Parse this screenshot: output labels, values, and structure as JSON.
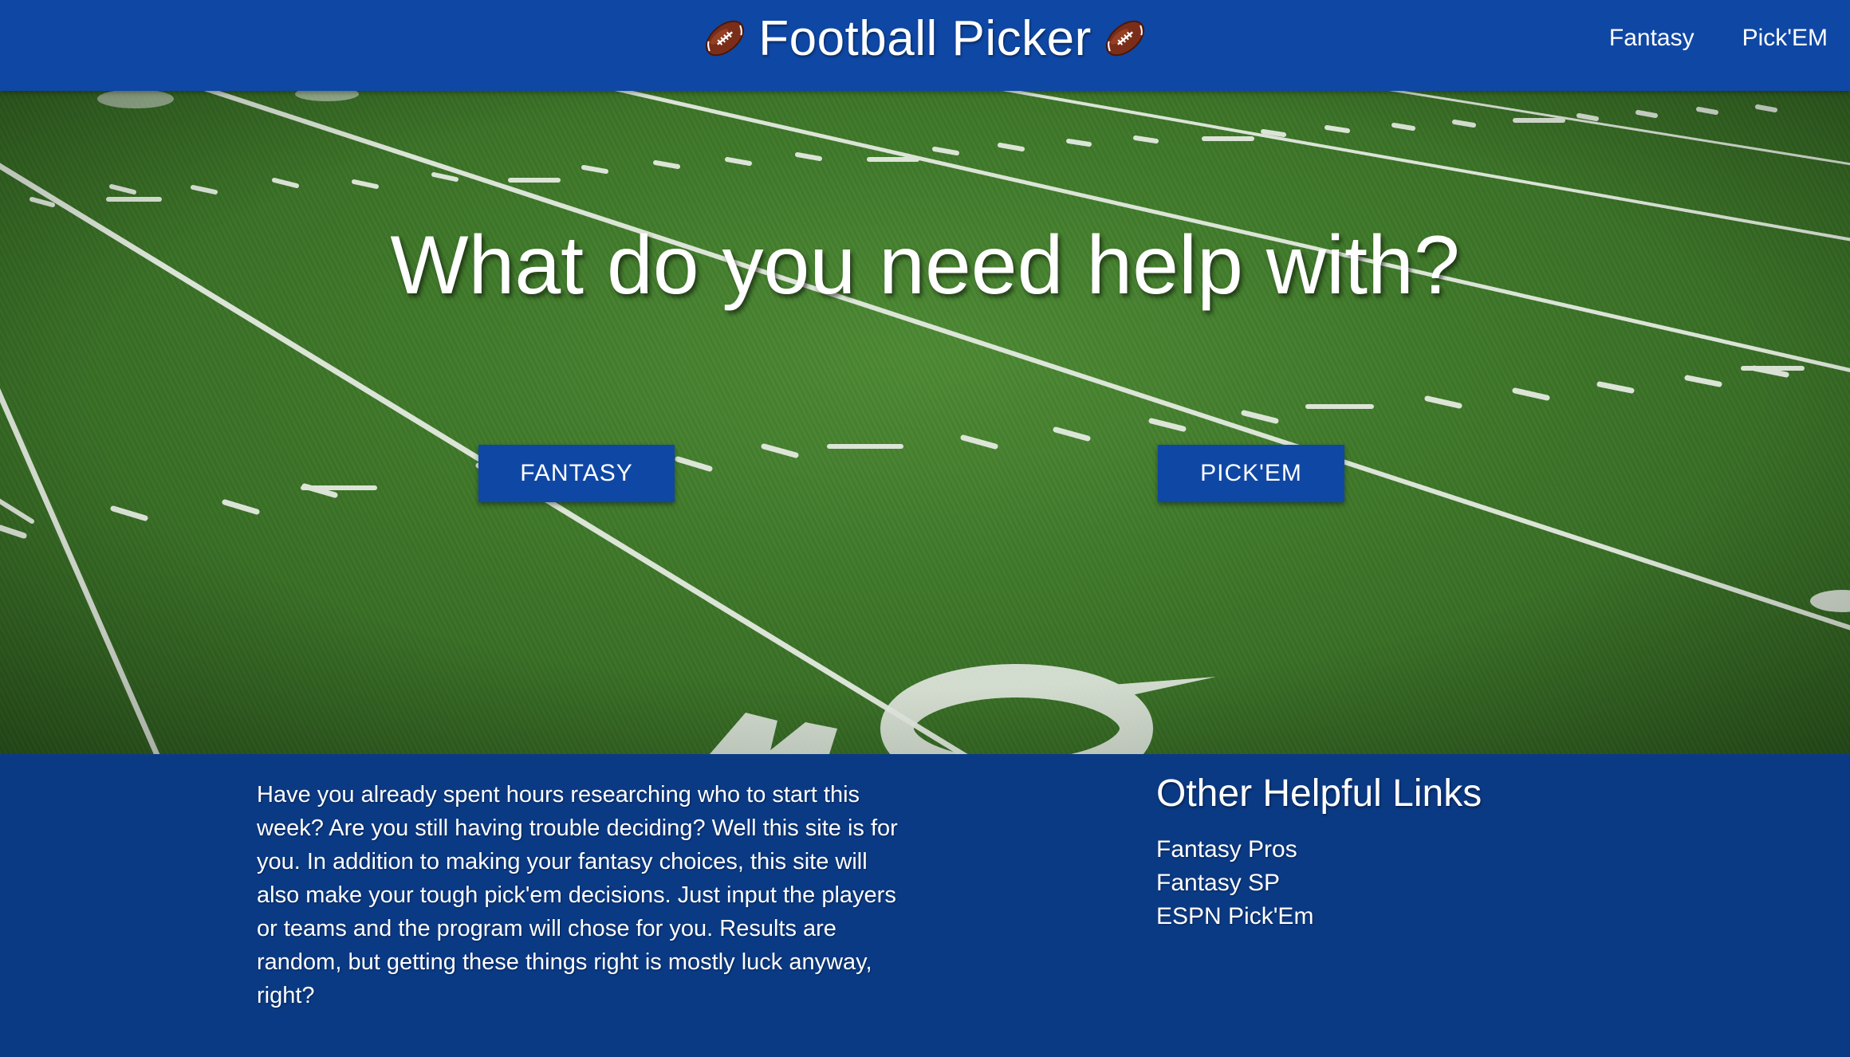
{
  "navbar": {
    "brand_icon": "football-icon",
    "brand_title": "Football Picker",
    "links": [
      {
        "label": "Fantasy"
      },
      {
        "label": "Pick'EM"
      }
    ]
  },
  "hero": {
    "headline": "What do you need help with?",
    "background": "football-field-image",
    "buttons": [
      {
        "label": "FANTASY"
      },
      {
        "label": "PICK'EM"
      }
    ]
  },
  "footer": {
    "about_text": "Have you already spent hours researching who to start this week? Are you still having trouble deciding? Well this site is for you. In addition to making your fantasy choices, this site will also make your tough pick'em decisions. Just input the players or teams and the program will chose for you. Results are random, but getting these things right is mostly luck anyway, right?",
    "links_title": "Other Helpful Links",
    "links": [
      {
        "label": "Fantasy Pros"
      },
      {
        "label": "Fantasy SP"
      },
      {
        "label": "ESPN Pick'Em"
      }
    ]
  },
  "colors": {
    "navbar_blue": "#0f47a5",
    "footer_blue": "#0b3a85",
    "turf_green": "#3d7628",
    "text": "#ffffff"
  }
}
